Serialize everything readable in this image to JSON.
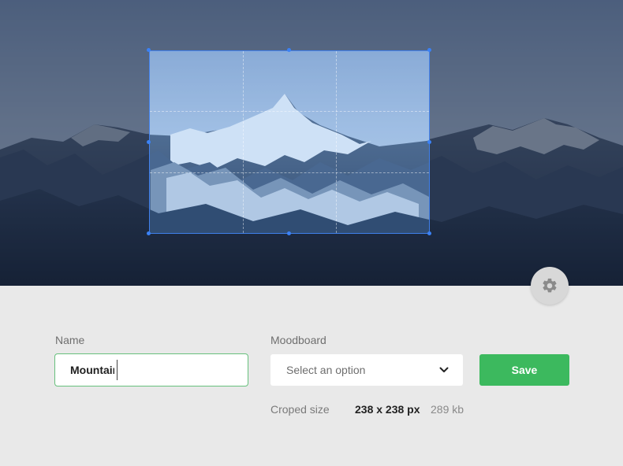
{
  "form": {
    "name_label": "Name",
    "name_value": "Mountains",
    "moodboard_label": "Moodboard",
    "moodboard_placeholder": "Select an option",
    "save_label": "Save"
  },
  "crop_info": {
    "label": "Croped size",
    "dimensions": "238 x 238 px",
    "file_size": "289 kb"
  },
  "icons": {
    "settings": "gear-icon",
    "dropdown": "chevron-down-icon"
  },
  "colors": {
    "accent_green": "#3cb95e",
    "input_focus_border": "#67c07d",
    "crop_border": "#4285f4",
    "panel_background": "#e9e9e9"
  }
}
